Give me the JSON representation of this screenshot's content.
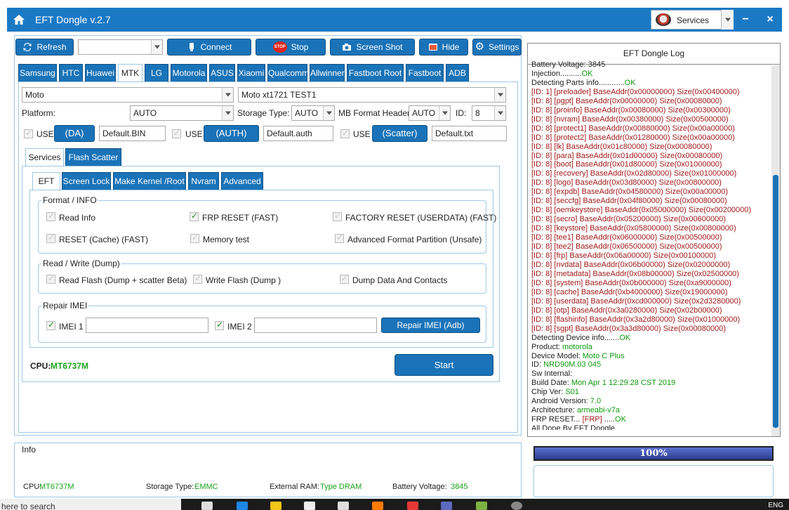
{
  "window": {
    "title": "EFT Dongle  v.2.7",
    "minimize": "−",
    "close": "×"
  },
  "services": {
    "label": "Services"
  },
  "toolbar": {
    "refresh": "Refresh",
    "connect": "Connect",
    "stop": "Stop",
    "stop_badge": "STOP",
    "screenshot": "Screen Shot",
    "hide": "Hide",
    "settings": "Settings"
  },
  "brand_tabs": [
    "Samsung",
    "HTC",
    "Huawei",
    "MTK",
    "LG",
    "Motorola",
    "ASUS",
    "Xiaomi",
    "Qualcomm",
    "Allwinner",
    "Fastboot Root",
    "Fastboot",
    "ADB"
  ],
  "brand_active": "MTK",
  "selectors": {
    "brand": "Moto",
    "model": "Moto xt1721 TEST1",
    "platform_label": "Platform:",
    "platform": "AUTO",
    "storage_label": "Storage Type:",
    "storage": "AUTO",
    "mbformat_label": "MB Format Header",
    "mbformat": "AUTO",
    "id_label": "ID:",
    "id": "8"
  },
  "files": {
    "use_label": "USE",
    "da_btn": "(DA)",
    "da_file": "Default.BIN",
    "auth_btn": "(AUTH)",
    "auth_file": "Default.auth",
    "scatter_btn": "(Scatter)",
    "scatter_file": "Default.txt"
  },
  "sub_tabs": [
    "Services",
    "Flash Scatter"
  ],
  "inner_tabs": [
    "EFT",
    "Screen Lock",
    "Make Kernel  /Root",
    "Nvram",
    "Advanced"
  ],
  "format_group": {
    "title": "Format / INFO",
    "read_info": "Read Info",
    "frp_reset": "FRP RESET (FAST)",
    "factory_reset": "FACTORY RESET (USERDATA) (FAST)",
    "reset_cache": "RESET (Cache) (FAST)",
    "memory_test": "Memory test",
    "adv_format": "Advanced Format Partition (Unsafe)"
  },
  "rw_group": {
    "title": "Read / Write (Dump)",
    "read_flash": "Read Flash (Dump + scatter Beta)",
    "write_flash": "Write Flash (Dump )",
    "dump_data": "Dump Data And Contacts"
  },
  "imei_group": {
    "title": "Repair IMEI",
    "imei1": "IMEI 1",
    "imei2": "IMEI 2",
    "repair_btn": "Repair IMEI (Adb)"
  },
  "cpu": {
    "label": "CPU:",
    "value": "MT6737M"
  },
  "start_btn": "Start",
  "info": {
    "title": "Info",
    "cpu_label": "CPU:",
    "cpu_value": "MT6737M",
    "storage_label": "Storage Type:",
    "storage_value": "EMMC",
    "ram_label": "External RAM:",
    "ram_value": "Type DRAM",
    "battery_label": "Battery Voltage:",
    "battery_value": "3845"
  },
  "log": {
    "title": "EFT Dongle Log",
    "lines": [
      [
        [
          "Battery Voltage: 3845",
          ""
        ]
      ],
      [
        [
          "Injection..........",
          ""
        ],
        [
          "OK",
          "g"
        ]
      ],
      [
        [
          "Detecting Parts info............",
          ""
        ],
        [
          "OK",
          "g"
        ]
      ],
      [
        [
          "[ID: 1] [preloader] BaseAddr(0x00000000) Size(0x00400000)",
          "r"
        ]
      ],
      [
        [
          "[ID: 8] [pgpt] BaseAddr(0x00000000) Size(0x00080000)",
          "r"
        ]
      ],
      [
        [
          "[ID: 8] [proinfo] BaseAddr(0x00080000) Size(0x00300000)",
          "r"
        ]
      ],
      [
        [
          "[ID: 8] [nvram] BaseAddr(0x00380000) Size(0x00500000)",
          "r"
        ]
      ],
      [
        [
          "[ID: 8] [protect1] BaseAddr(0x00880000) Size(0x00a00000)",
          "r"
        ]
      ],
      [
        [
          "[ID: 8] [protect2] BaseAddr(0x01280000) Size(0x00a00000)",
          "r"
        ]
      ],
      [
        [
          "[ID: 8] [lk] BaseAddr(0x01c80000) Size(0x00080000)",
          "r"
        ]
      ],
      [
        [
          "[ID: 8] [para] BaseAddr(0x01d00000) Size(0x00080000)",
          "r"
        ]
      ],
      [
        [
          "[ID: 8] [boot] BaseAddr(0x01d80000) Size(0x01000000)",
          "r"
        ]
      ],
      [
        [
          "[ID: 8] [recovery] BaseAddr(0x02d80000) Size(0x01000000)",
          "r"
        ]
      ],
      [
        [
          "[ID: 8] [logo] BaseAddr(0x03d80000) Size(0x00800000)",
          "r"
        ]
      ],
      [
        [
          "[ID: 8] [expdb] BaseAddr(0x04580000) Size(0x00a00000)",
          "r"
        ]
      ],
      [
        [
          "[ID: 8] [seccfg] BaseAddr(0x04f80000) Size(0x00080000)",
          "r"
        ]
      ],
      [
        [
          "[ID: 8] [oemkeystore] BaseAddr(0x05000000) Size(0x00200000)",
          "r"
        ]
      ],
      [
        [
          "[ID: 8] [secro] BaseAddr(0x05200000) Size(0x00600000)",
          "r"
        ]
      ],
      [
        [
          "[ID: 8] [keystore] BaseAddr(0x05800000) Size(0x00800000)",
          "r"
        ]
      ],
      [
        [
          "[ID: 8] [tee1] BaseAddr(0x06000000) Size(0x00500000)",
          "r"
        ]
      ],
      [
        [
          "[ID: 8] [tee2] BaseAddr(0x06500000) Size(0x00500000)",
          "r"
        ]
      ],
      [
        [
          "[ID: 8] [frp] BaseAddr(0x06a00000) Size(0x00100000)",
          "r"
        ]
      ],
      [
        [
          "[ID: 8] [nvdata] BaseAddr(0x06b00000) Size(0x02000000)",
          "r"
        ]
      ],
      [
        [
          "[ID: 8] [metadata] BaseAddr(0x08b00000) Size(0x02500000)",
          "r"
        ]
      ],
      [
        [
          "[ID: 8] [system] BaseAddr(0x0b000000) Size(0xa9000000)",
          "r"
        ]
      ],
      [
        [
          "[ID: 8] [cache] BaseAddr(0xb4000000) Size(0x19000000)",
          "r"
        ]
      ],
      [
        [
          "[ID: 8] [userdata] BaseAddr(0xcd000000) Size(0x2d3280000)",
          "r"
        ]
      ],
      [
        [
          "[ID: 8] [otp] BaseAddr(0x3a0280000) Size(0x02b00000)",
          "r"
        ]
      ],
      [
        [
          "[ID: 8] [flashinfo] BaseAddr(0x3a2d80000) Size(0x01000000)",
          "r"
        ]
      ],
      [
        [
          "[ID: 8] [sgpt] BaseAddr(0x3a3d80000) Size(0x00080000)",
          "r"
        ]
      ],
      [
        [
          "Detecting Device info.......",
          ""
        ],
        [
          "OK",
          "g"
        ]
      ],
      [
        [
          "Product: ",
          ""
        ],
        [
          "motorola",
          "g"
        ]
      ],
      [
        [
          "Device Model: ",
          ""
        ],
        [
          "Moto C Plus",
          "g"
        ]
      ],
      [
        [
          "ID: ",
          ""
        ],
        [
          "NRD90M.03 045",
          "g"
        ]
      ],
      [
        [
          "Sw Internal: ",
          ""
        ]
      ],
      [
        [
          "Build Date: ",
          ""
        ],
        [
          "Mon Apr 1 12:29:28 CST 2019",
          "g"
        ]
      ],
      [
        [
          "Chip Ver: ",
          ""
        ],
        [
          "S01",
          "g"
        ]
      ],
      [
        [
          "Android Version: ",
          ""
        ],
        [
          "7.0",
          "g"
        ]
      ],
      [
        [
          "Architecture: ",
          ""
        ],
        [
          "armeabi-v7a",
          "g"
        ]
      ],
      [
        [
          "FRP RESET... ",
          ""
        ],
        [
          "[FRP]",
          "r"
        ],
        [
          " .....",
          ""
        ],
        [
          "OK",
          "g"
        ]
      ],
      [
        [
          "All Done By EFT Dongle",
          ""
        ]
      ]
    ]
  },
  "progress": {
    "value": 1.0,
    "label": "100%"
  },
  "taskbar": {
    "search": "here to search",
    "tray_lang": "ENG"
  }
}
